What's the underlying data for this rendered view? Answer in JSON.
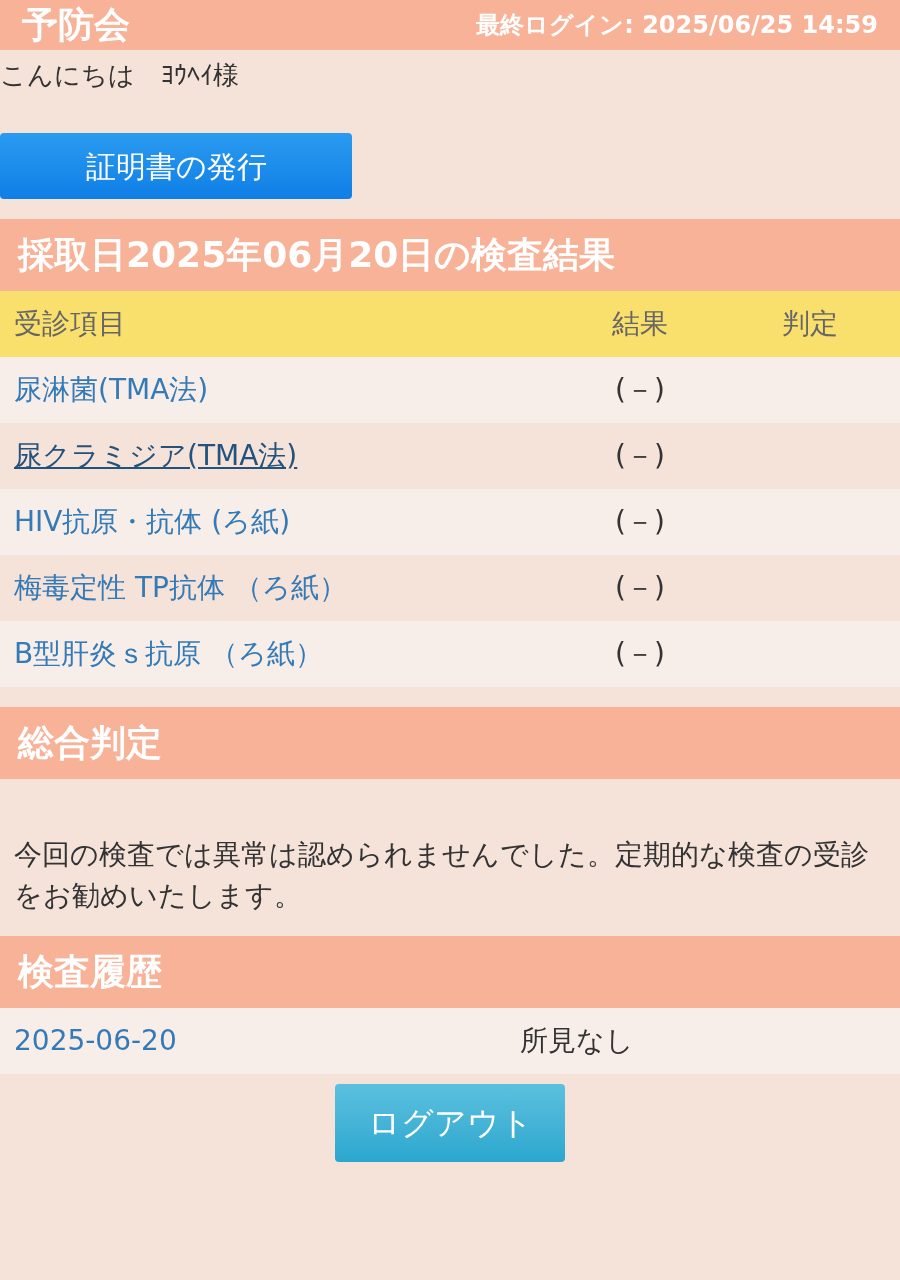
{
  "header": {
    "title": "予防会",
    "last_login": "最終ログイン: 2025/06/25 14:59"
  },
  "greeting": "こんにちは　ﾖｳﾍｲ様",
  "certificate_button": "証明書の発行",
  "results": {
    "title": "採取日2025年06月20日の検査結果",
    "columns": [
      "受診項目",
      "結果",
      "判定"
    ],
    "rows": [
      {
        "item": "尿淋菌(TMA法)",
        "result": "(－)",
        "hovered": false
      },
      {
        "item": "尿クラミジア(TMA法)",
        "result": "(－)",
        "hovered": true
      },
      {
        "item": "HIV抗原・抗体 (ろ紙)",
        "result": "(－)",
        "hovered": false
      },
      {
        "item": "梅毒定性 TP抗体 （ろ紙）",
        "result": "(－)",
        "hovered": false
      },
      {
        "item": "B型肝炎ｓ抗原 （ろ紙）",
        "result": "(－)",
        "hovered": false
      }
    ]
  },
  "overall": {
    "title": "総合判定",
    "text": "今回の検査では異常は認められませんでした。定期的な検査の受診をお勧めいたします。"
  },
  "history": {
    "title": "検査履歴",
    "rows": [
      {
        "date": "2025-06-20",
        "finding": "所見なし"
      }
    ]
  },
  "logout_button": "ログアウト"
}
